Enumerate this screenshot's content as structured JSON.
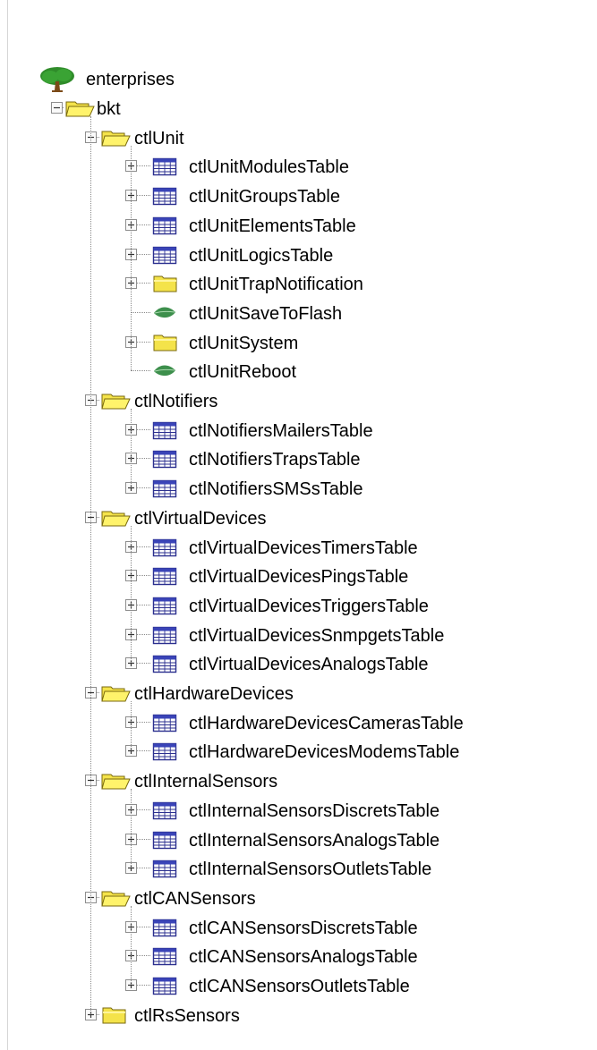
{
  "tree": {
    "root": {
      "label": "enterprises",
      "icon": "tree-icon"
    },
    "nodes": [
      {
        "label": "bkt",
        "level": 1,
        "icon": "folder-open-icon",
        "expander": "minus"
      },
      {
        "label": "ctlUnit",
        "level": 2,
        "icon": "folder-open-icon",
        "expander": "minus"
      },
      {
        "label": "ctlUnitModulesTable",
        "level": 3,
        "icon": "table-icon",
        "expander": "plus"
      },
      {
        "label": "ctlUnitGroupsTable",
        "level": 3,
        "icon": "table-icon",
        "expander": "plus"
      },
      {
        "label": "ctlUnitElementsTable",
        "level": 3,
        "icon": "table-icon",
        "expander": "plus"
      },
      {
        "label": "ctlUnitLogicsTable",
        "level": 3,
        "icon": "table-icon",
        "expander": "plus"
      },
      {
        "label": "ctlUnitTrapNotification",
        "level": 3,
        "icon": "folder-icon",
        "expander": "plus"
      },
      {
        "label": "ctlUnitSaveToFlash",
        "level": 3,
        "icon": "leaf-icon",
        "expander": "none"
      },
      {
        "label": "ctlUnitSystem",
        "level": 3,
        "icon": "folder-icon",
        "expander": "plus"
      },
      {
        "label": "ctlUnitReboot",
        "level": 3,
        "icon": "leaf-icon",
        "expander": "none"
      },
      {
        "label": "ctlNotifiers",
        "level": 2,
        "icon": "folder-open-icon",
        "expander": "minus"
      },
      {
        "label": "ctlNotifiersMailersTable",
        "level": 3,
        "icon": "table-icon",
        "expander": "plus"
      },
      {
        "label": "ctlNotifiersTrapsTable",
        "level": 3,
        "icon": "table-icon",
        "expander": "plus"
      },
      {
        "label": "ctlNotifiersSMSsTable",
        "level": 3,
        "icon": "table-icon",
        "expander": "plus"
      },
      {
        "label": "ctlVirtualDevices",
        "level": 2,
        "icon": "folder-open-icon",
        "expander": "minus"
      },
      {
        "label": "ctlVirtualDevicesTimersTable",
        "level": 3,
        "icon": "table-icon",
        "expander": "plus"
      },
      {
        "label": "ctlVirtualDevicesPingsTable",
        "level": 3,
        "icon": "table-icon",
        "expander": "plus"
      },
      {
        "label": "ctlVirtualDevicesTriggersTable",
        "level": 3,
        "icon": "table-icon",
        "expander": "plus"
      },
      {
        "label": "ctlVirtualDevicesSnmpgetsTable",
        "level": 3,
        "icon": "table-icon",
        "expander": "plus"
      },
      {
        "label": "ctlVirtualDevicesAnalogsTable",
        "level": 3,
        "icon": "table-icon",
        "expander": "plus"
      },
      {
        "label": "ctlHardwareDevices",
        "level": 2,
        "icon": "folder-open-icon",
        "expander": "minus"
      },
      {
        "label": "ctlHardwareDevicesCamerasTable",
        "level": 3,
        "icon": "table-icon",
        "expander": "plus"
      },
      {
        "label": "ctlHardwareDevicesModemsTable",
        "level": 3,
        "icon": "table-icon",
        "expander": "plus"
      },
      {
        "label": "ctlInternalSensors",
        "level": 2,
        "icon": "folder-open-icon",
        "expander": "minus"
      },
      {
        "label": "ctlInternalSensorsDiscretsTable",
        "level": 3,
        "icon": "table-icon",
        "expander": "plus"
      },
      {
        "label": "ctlInternalSensorsAnalogsTable",
        "level": 3,
        "icon": "table-icon",
        "expander": "plus"
      },
      {
        "label": "ctlInternalSensorsOutletsTable",
        "level": 3,
        "icon": "table-icon",
        "expander": "plus"
      },
      {
        "label": "ctlCANSensors",
        "level": 2,
        "icon": "folder-open-icon",
        "expander": "minus"
      },
      {
        "label": "ctlCANSensorsDiscretsTable",
        "level": 3,
        "icon": "table-icon",
        "expander": "plus"
      },
      {
        "label": "ctlCANSensorsAnalogsTable",
        "level": 3,
        "icon": "table-icon",
        "expander": "plus"
      },
      {
        "label": "ctlCANSensorsOutletsTable",
        "level": 3,
        "icon": "table-icon",
        "expander": "plus"
      },
      {
        "label": "ctlRsSensors",
        "level": 2,
        "icon": "folder-icon",
        "expander": "plus"
      }
    ]
  },
  "colors": {
    "folder_fill": "#f4e34a",
    "folder_stroke": "#7a6a0f",
    "table_stroke": "#2b2f8f",
    "table_header": "#3a44b8",
    "leaf": "#3d8f4c",
    "tree_foliage": "#2f8c2a",
    "tree_trunk": "#7b4a18"
  }
}
